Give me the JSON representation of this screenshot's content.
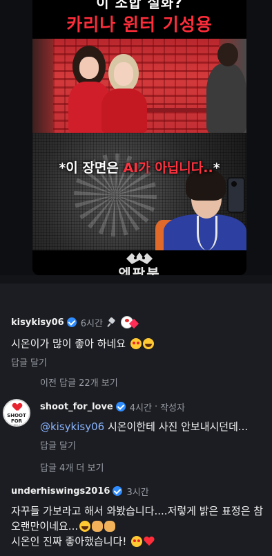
{
  "video": {
    "title_line1": "이 조합 실화?",
    "title_line2": "카리나 윈터 기성용",
    "caption_prefix": "*이 장면은 ",
    "caption_accent": "AI가 아닙니다..",
    "caption_suffix": "*",
    "channel_name": "엠팍붐"
  },
  "comments": {
    "c1": {
      "username": "kisykisy06",
      "time": "6시간",
      "text": "시온이가 많이 좋아 하네요",
      "emojis": [
        "heart-eyes-emoji",
        "laughing-emoji"
      ],
      "reply_label": "답글 달기"
    },
    "prev_replies": "이전 답글 22개 보기",
    "c2": {
      "username": "shoot_for_love",
      "time": "4시간",
      "author_tag": "작성자",
      "mention": "@kisykisy06",
      "text": " 시온이한테 사진 안보내시던데...",
      "reply_label": "답글 달기",
      "avatar_text": "SHOOT FOR LOVE"
    },
    "more_replies": "답글 4개 더 보기",
    "c3": {
      "username": "underhiswings2016",
      "time": "3시간",
      "text_part1": "자꾸들 가보라고 해서 와봤습니다....저렇게 밝은 표정은 참 오랜만이네요...",
      "text_part2": "시온인 진짜 좋아했습니다!",
      "emojis": [
        "laughing-emoji",
        "clap-emoji",
        "clap-emoji",
        "heart-eyes-emoji",
        "red-heart-emoji"
      ]
    }
  },
  "colors": {
    "accent_red": "#ff2c3a",
    "verified_blue": "#2f8cff",
    "mention_blue": "#8ab4ff",
    "background": "#1b1d22"
  }
}
